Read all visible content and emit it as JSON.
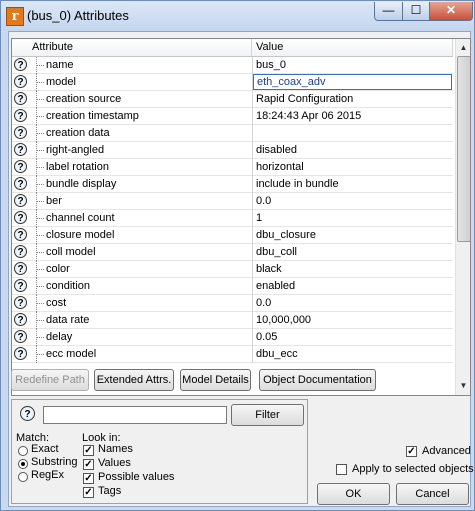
{
  "window": {
    "title": "(bus_0) Attributes",
    "app_icon": "r",
    "minimize_glyph": "—",
    "maximize_glyph": "☐",
    "close_glyph": "✕"
  },
  "grid": {
    "headers": {
      "attribute": "Attribute",
      "value": "Value"
    },
    "help_glyph": "?",
    "rows": [
      {
        "name": "name",
        "value": "bus_0"
      },
      {
        "name": "model",
        "value": "eth_coax_adv"
      },
      {
        "name": "creation source",
        "value": "Rapid Configuration"
      },
      {
        "name": "creation timestamp",
        "value": "18:24:43 Apr 06 2015"
      },
      {
        "name": "creation data",
        "value": ""
      },
      {
        "name": "right-angled",
        "value": "disabled"
      },
      {
        "name": "label rotation",
        "value": "horizontal"
      },
      {
        "name": "bundle display",
        "value": "include in bundle"
      },
      {
        "name": "ber",
        "value": "0.0"
      },
      {
        "name": "channel count",
        "value": "1"
      },
      {
        "name": "closure model",
        "value": "dbu_closure"
      },
      {
        "name": "coll model",
        "value": "dbu_coll"
      },
      {
        "name": "color",
        "value": "black"
      },
      {
        "name": "condition",
        "value": "enabled"
      },
      {
        "name": "cost",
        "value": "0.0"
      },
      {
        "name": "data rate",
        "value": "10,000,000"
      },
      {
        "name": "delay",
        "value": "0.05"
      },
      {
        "name": "ecc model",
        "value": "dbu_ecc"
      }
    ],
    "scroll_up": "▲",
    "scroll_down": "▼"
  },
  "buttons": {
    "redefine_path": "Redefine Path",
    "extended_attrs": "Extended Attrs.",
    "model_details": "Model Details",
    "object_documentation": "Object Documentation",
    "filter": "Filter",
    "ok": "OK",
    "cancel": "Cancel"
  },
  "search": {
    "help_glyph": "?",
    "value": "",
    "match_label": "Match:",
    "match_options": [
      "Exact",
      "Substring",
      "RegEx"
    ],
    "match_selected": "Substring",
    "look_in_label": "Look in:",
    "look_in_options": [
      "Names",
      "Values",
      "Possible values",
      "Tags"
    ],
    "check_glyph": "✓"
  },
  "options": {
    "advanced_label": "Advanced",
    "advanced_checked": true,
    "apply_selected_label": "Apply to selected objects",
    "apply_selected_checked": false
  }
}
